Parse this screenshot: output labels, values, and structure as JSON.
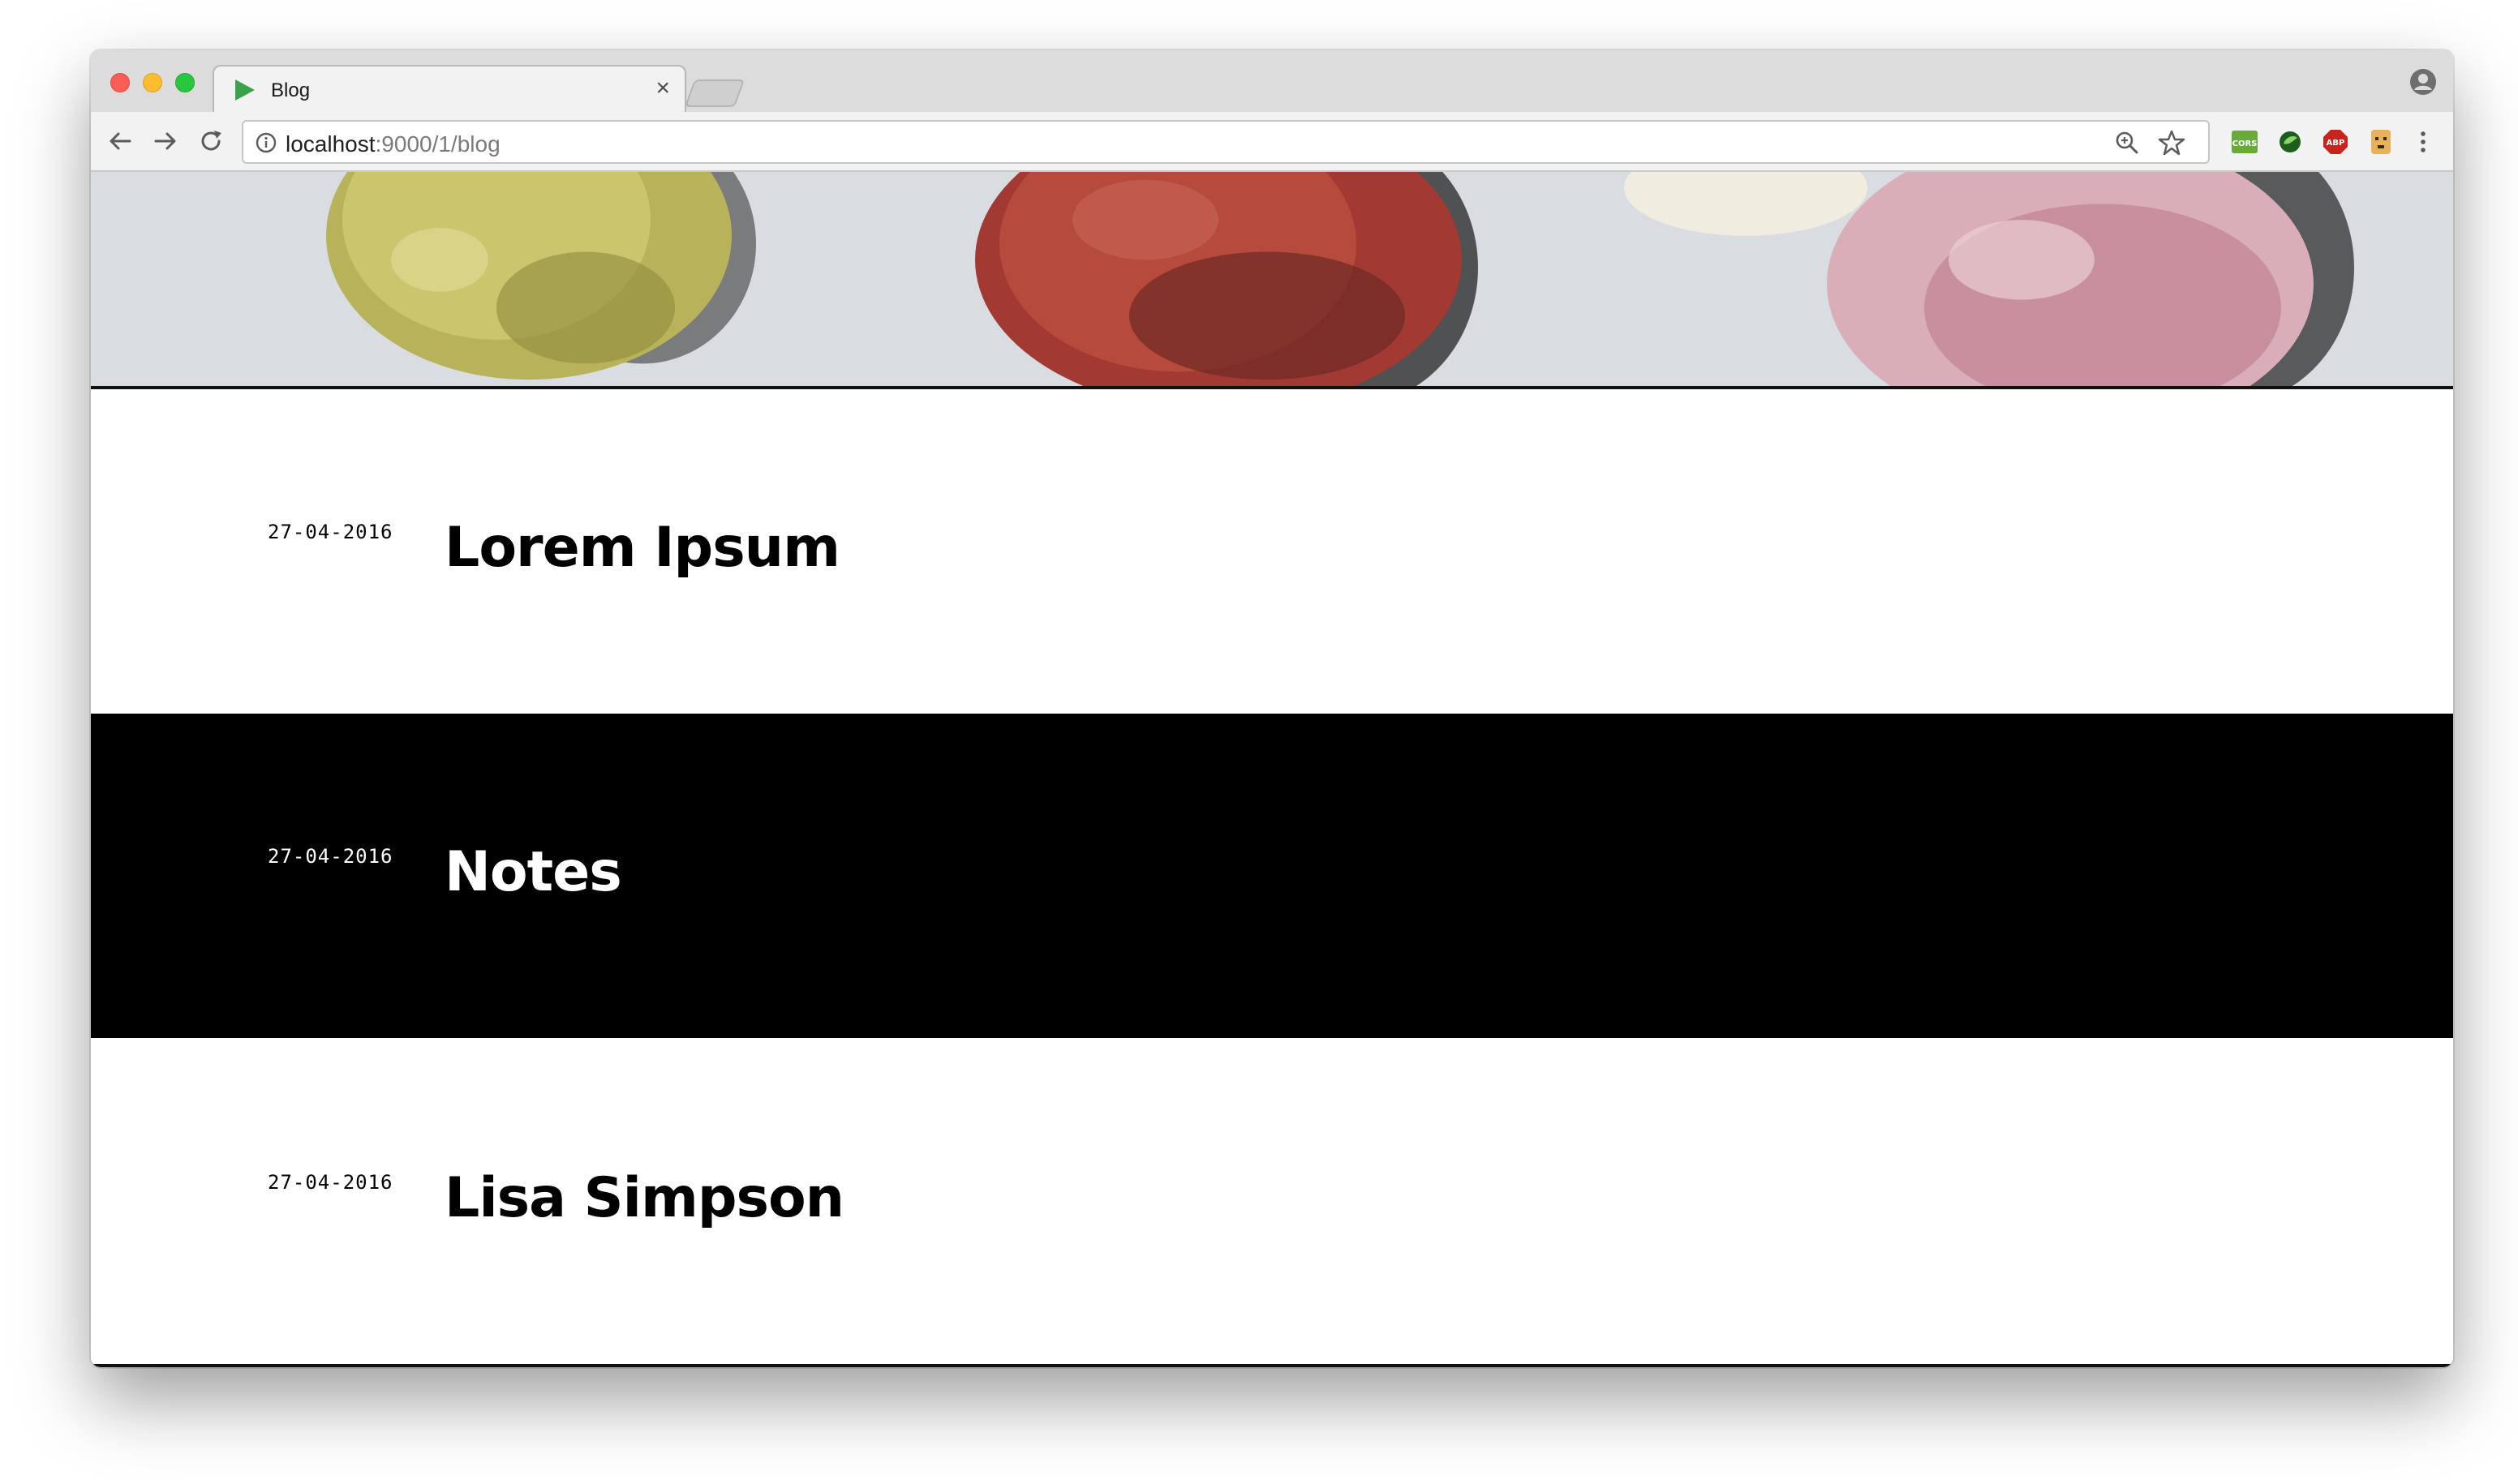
{
  "browser": {
    "tab_title": "Blog",
    "tab_close": "×",
    "url_host": "localhost",
    "url_rest": ":9000/1/blog",
    "extensions": [
      {
        "name": "cors-extension-icon",
        "label": "CORS",
        "color": "#6aaa3a"
      },
      {
        "name": "green-extension-icon",
        "label": "",
        "color": "#2f7a2f"
      },
      {
        "name": "adblock-plus-icon",
        "label": "ABP",
        "color": "#c7231f"
      },
      {
        "name": "face-extension-icon",
        "label": "",
        "color": "#e7b25a"
      }
    ]
  },
  "hero": {
    "image_description_colors": [
      "#c3c06a",
      "#b83a33",
      "#e9c9cf"
    ]
  },
  "posts": [
    {
      "date": "27-04-2016",
      "title": "Lorem Ipsum"
    },
    {
      "date": "27-04-2016",
      "title": "Notes"
    },
    {
      "date": "27-04-2016",
      "title": "Lisa Simpson"
    }
  ],
  "colors": {
    "row_dark": "#000000",
    "row_light": "#ffffff",
    "tab_play_icon": "#3aa34a"
  }
}
